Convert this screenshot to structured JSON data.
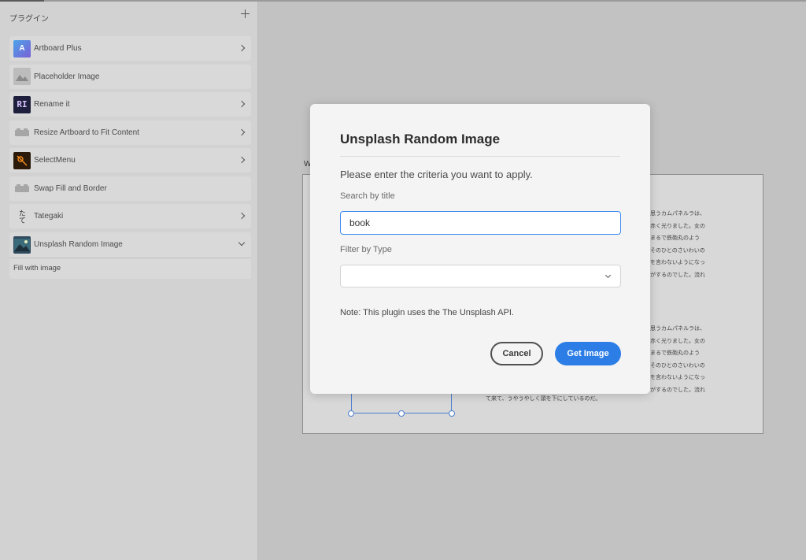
{
  "sidebar": {
    "title": "プラグイン",
    "items": [
      {
        "label": "Artboard Plus",
        "icon": "artboard-plus-icon",
        "has_chevron": true
      },
      {
        "label": "Placeholder Image",
        "icon": "placeholder-image-icon",
        "has_chevron": false
      },
      {
        "label": "Rename it",
        "icon": "rename-it-icon",
        "icon_text": "RI",
        "has_chevron": true
      },
      {
        "label": "Resize Artboard to Fit Content",
        "icon": "plugin-block-icon",
        "has_chevron": true
      },
      {
        "label": "SelectMenu",
        "icon": "selectmenu-icon",
        "has_chevron": true
      },
      {
        "label": "Swap Fill and Border",
        "icon": "plugin-block-icon",
        "has_chevron": false
      },
      {
        "label": "Tategaki",
        "icon": "tategaki-icon",
        "icon_text": "たて",
        "has_chevron": true
      },
      {
        "label": "Unsplash Random Image",
        "icon": "unsplash-icon",
        "expanded": true
      }
    ],
    "submenu": {
      "label": "Fill with image"
    }
  },
  "canvas": {
    "artboard_label": "W",
    "text_block_1": [
      "思うカムパネルラは、",
      "赤く光りました。女の",
      "まるで鉄砲丸のよう",
      "そのひとのさいわいの",
      "を言わないようになっ",
      "がするのでした。流れ"
    ],
    "text_block_2": [
      "思うカムパネルラは、",
      "赤く光りました。女の",
      "まるで鉄砲丸のよう",
      "そのひとのさいわいの",
      "を言わないようになっ",
      "がするのでした。流れ"
    ],
    "text_tail": "て来て、うやうやしく頭を下にしているのだ。"
  },
  "modal": {
    "title": "Unsplash Random Image",
    "description": "Please enter the criteria you want to apply.",
    "search_label": "Search by title",
    "search_value": "book",
    "filter_label": "Filter by Type",
    "filter_value": "",
    "note": "Note: This plugin uses the The Unsplash API.",
    "cancel_label": "Cancel",
    "submit_label": "Get Image"
  },
  "colors": {
    "accent": "#2c7ee6",
    "input_focus": "#3e8af0",
    "selection": "#4d7fd0"
  }
}
